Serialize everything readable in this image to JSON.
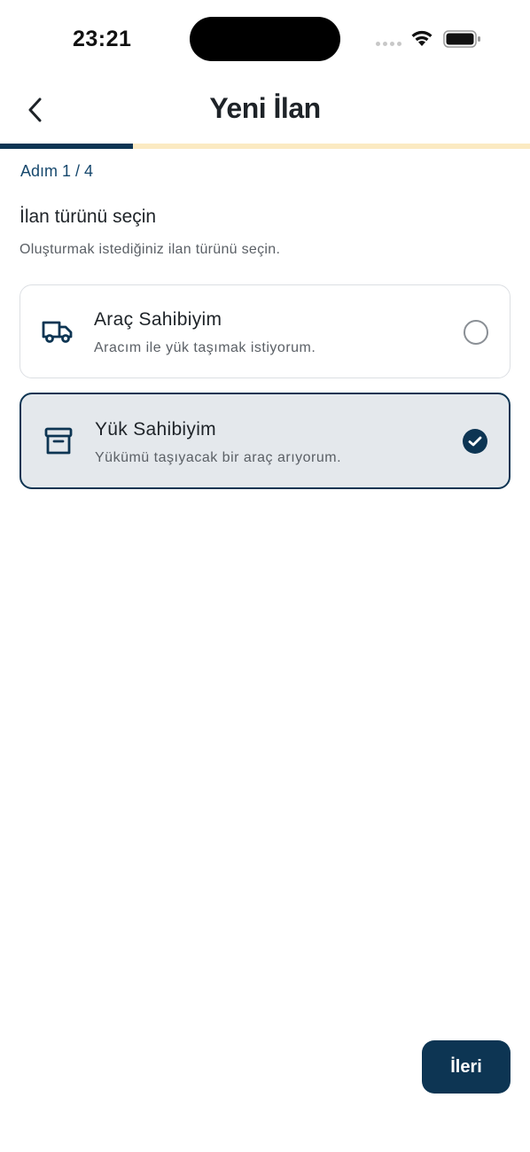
{
  "status_bar": {
    "time": "23:21",
    "icons": [
      "signal-icon",
      "wifi-icon",
      "battery-icon"
    ]
  },
  "header": {
    "title": "Yeni İlan",
    "back_icon": "chevron-left-icon"
  },
  "progress": {
    "current_step": 1,
    "total_steps": 4,
    "fraction": 0.25,
    "step_label": "Adım 1 / 4",
    "fill_color": "#0d3553",
    "track_color": "#fbeac2"
  },
  "section": {
    "title": "İlan türünü seçin",
    "subtitle": "Oluşturmak istediğiniz ilan türünü seçin."
  },
  "options": [
    {
      "icon": "truck-icon",
      "title": "Araç Sahibiyim",
      "description": "Aracım ile yük taşımak istiyorum.",
      "selected": false
    },
    {
      "icon": "archive-box-icon",
      "title": "Yük Sahibiyim",
      "description": "Yükümü taşıyacak bir araç arıyorum.",
      "selected": true
    }
  ],
  "footer": {
    "next_label": "İleri"
  },
  "colors": {
    "primary": "#0d3553",
    "selected_bg": "#e4e8ec"
  }
}
